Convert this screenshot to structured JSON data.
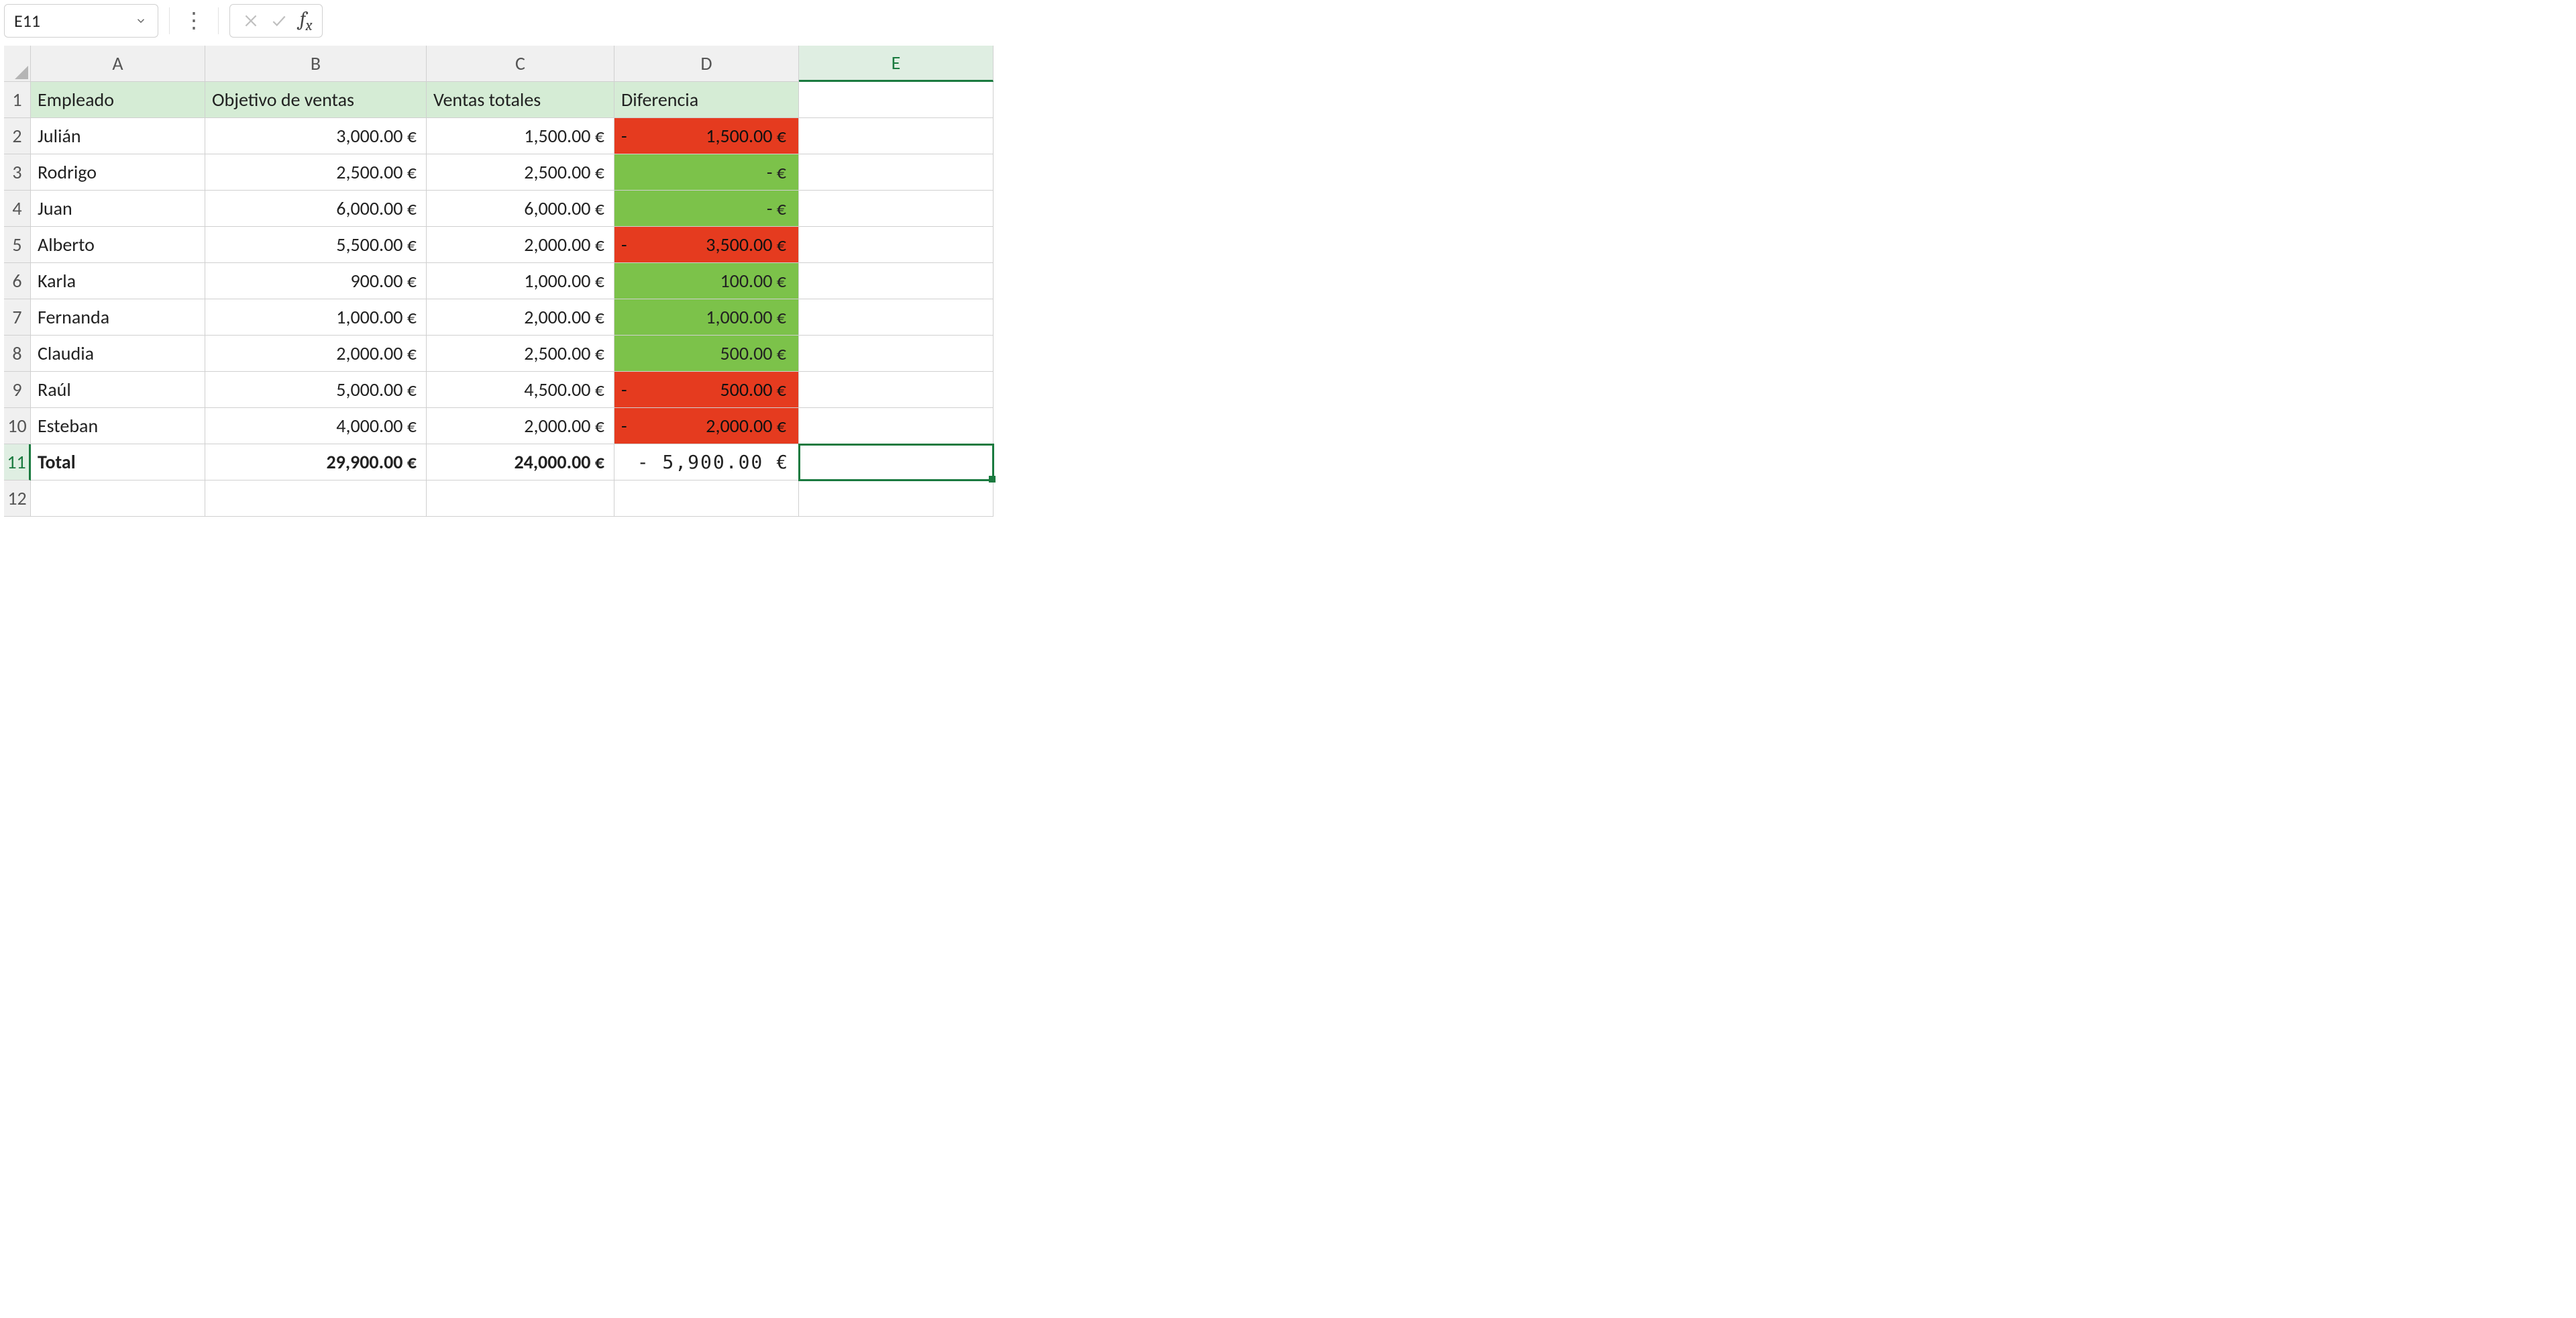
{
  "namebox": {
    "value": "E11"
  },
  "columns": [
    "A",
    "B",
    "C",
    "D",
    "E"
  ],
  "active_cell": {
    "col": "E",
    "row": 11
  },
  "headers": {
    "empleado": "Empleado",
    "objetivo": "Objetivo de ventas",
    "ventas": "Ventas totales",
    "diferencia": "Diferencia"
  },
  "rows": [
    {
      "n": 2,
      "empleado": "Julián",
      "objetivo": "3,000.00 €",
      "ventas": "1,500.00 €",
      "diff_sign": "-",
      "diff_val": "1,500.00 €",
      "diff_kind": "red"
    },
    {
      "n": 3,
      "empleado": "Rodrigo",
      "objetivo": "2,500.00 €",
      "ventas": "2,500.00 €",
      "diff_sign": "",
      "diff_val": "-   €",
      "diff_kind": "green"
    },
    {
      "n": 4,
      "empleado": "Juan",
      "objetivo": "6,000.00 €",
      "ventas": "6,000.00 €",
      "diff_sign": "",
      "diff_val": "-   €",
      "diff_kind": "green"
    },
    {
      "n": 5,
      "empleado": "Alberto",
      "objetivo": "5,500.00 €",
      "ventas": "2,000.00 €",
      "diff_sign": "-",
      "diff_val": "3,500.00 €",
      "diff_kind": "red"
    },
    {
      "n": 6,
      "empleado": "Karla",
      "objetivo": "900.00 €",
      "ventas": "1,000.00 €",
      "diff_sign": "",
      "diff_val": "100.00 €",
      "diff_kind": "green"
    },
    {
      "n": 7,
      "empleado": "Fernanda",
      "objetivo": "1,000.00 €",
      "ventas": "2,000.00 €",
      "diff_sign": "",
      "diff_val": "1,000.00 €",
      "diff_kind": "green"
    },
    {
      "n": 8,
      "empleado": "Claudia",
      "objetivo": "2,000.00 €",
      "ventas": "2,500.00 €",
      "diff_sign": "",
      "diff_val": "500.00 €",
      "diff_kind": "green"
    },
    {
      "n": 9,
      "empleado": "Raúl",
      "objetivo": "5,000.00 €",
      "ventas": "4,500.00 €",
      "diff_sign": "-",
      "diff_val": "500.00 €",
      "diff_kind": "red"
    },
    {
      "n": 10,
      "empleado": "Esteban",
      "objetivo": "4,000.00 €",
      "ventas": "2,000.00 €",
      "diff_sign": "-",
      "diff_val": "2,000.00 €",
      "diff_kind": "red"
    }
  ],
  "total": {
    "n": 11,
    "label": "Total",
    "objetivo": "29,900.00 €",
    "ventas": "24,000.00 €",
    "diferencia": "- 5,900.00 €"
  },
  "trailing_rows": [
    12
  ]
}
